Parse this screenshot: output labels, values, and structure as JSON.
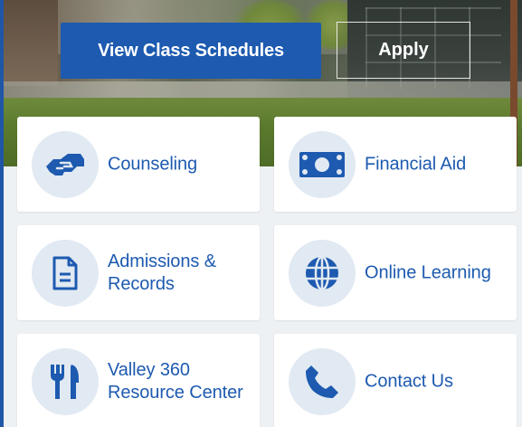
{
  "hero": {
    "primary_button": "View Class Schedules",
    "secondary_button": "Apply"
  },
  "cards": [
    {
      "label": "Counseling",
      "icon": "handshake-icon"
    },
    {
      "label": "Financial Aid",
      "icon": "money-bill-icon"
    },
    {
      "label": "Admissions & Records",
      "icon": "document-icon"
    },
    {
      "label": "Online Learning",
      "icon": "globe-icon"
    },
    {
      "label": "Valley 360 Resource Center",
      "icon": "utensils-icon"
    },
    {
      "label": "Contact Us",
      "icon": "phone-icon"
    }
  ],
  "colors": {
    "brand_blue": "#1d5ab0",
    "icon_bg": "#e1e9f2",
    "section_bg": "#eef1f4"
  }
}
